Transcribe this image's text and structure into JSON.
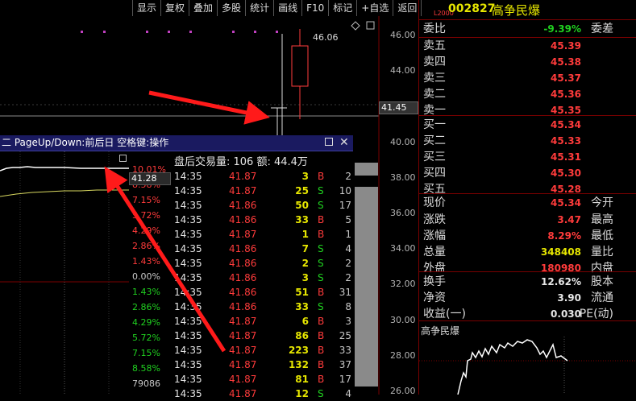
{
  "toolbar": [
    "显示",
    "复权",
    "叠加",
    "多股",
    "统计",
    "画线",
    "F10",
    "标记",
    "+自选",
    "返回"
  ],
  "stock": {
    "code": "002827",
    "name": "高争民爆",
    "badge": "L2000"
  },
  "quote": [
    {
      "label": "委比",
      "value": "-9.39%",
      "label2": "委差",
      "color": "#20d020"
    },
    {
      "label": "卖五",
      "value": "45.39",
      "label2": "",
      "color": "#ff3b3b"
    },
    {
      "label": "卖四",
      "value": "45.38",
      "label2": "",
      "color": "#ff3b3b"
    },
    {
      "label": "卖三",
      "value": "45.37",
      "label2": "",
      "color": "#ff3b3b"
    },
    {
      "label": "卖二",
      "value": "45.36",
      "label2": "",
      "color": "#ff3b3b"
    },
    {
      "label": "卖一",
      "value": "45.35",
      "label2": "",
      "color": "#ff3b3b"
    },
    {
      "label": "买一",
      "value": "45.34",
      "label2": "",
      "color": "#ff3b3b"
    },
    {
      "label": "买二",
      "value": "45.33",
      "label2": "",
      "color": "#ff3b3b"
    },
    {
      "label": "买三",
      "value": "45.31",
      "label2": "",
      "color": "#ff3b3b"
    },
    {
      "label": "买四",
      "value": "45.30",
      "label2": "",
      "color": "#ff3b3b"
    },
    {
      "label": "买五",
      "value": "45.28",
      "label2": "",
      "color": "#ff3b3b"
    },
    {
      "label": "现价",
      "value": "45.34",
      "label2": "今开",
      "color": "#ff3b3b"
    },
    {
      "label": "涨跌",
      "value": "3.47",
      "label2": "最高",
      "color": "#ff3b3b"
    },
    {
      "label": "涨幅",
      "value": "8.29%",
      "label2": "最低",
      "color": "#ff3b3b"
    },
    {
      "label": "总量",
      "value": "348408",
      "label2": "量比",
      "color": "#e6e600"
    },
    {
      "label": "外盘",
      "value": "180980",
      "label2": "内盘",
      "color": "#ff3b3b"
    },
    {
      "label": "换手",
      "value": "12.62%",
      "label2": "股本",
      "color": "#e6e6e6"
    },
    {
      "label": "净资",
      "value": "3.90",
      "label2": "流通",
      "color": "#e6e6e6"
    },
    {
      "label": "收益(一)",
      "value": "0.030",
      "label2": "PE(动)",
      "color": "#e6e6e6"
    }
  ],
  "mini_title": "高争民爆",
  "price_axis": [
    "46.00",
    "44.00",
    "42.00",
    "40.00",
    "38.00",
    "36.00",
    "34.00",
    "32.00",
    "30.00",
    "28.00",
    "26.00"
  ],
  "current_price_box": "41.45",
  "candle_high_label": "46.06",
  "popup": {
    "title": "二 PageUp/Down:前后日 空格键:操作",
    "header": "盘后交易量: 106  额: 44.4万",
    "cursor_price": "41.28",
    "pct_labels": [
      {
        "t": "10.01%",
        "c": "#ff3b3b"
      },
      {
        "t": "8.58%",
        "c": "#ff3b3b"
      },
      {
        "t": "7.15%",
        "c": "#ff3b3b"
      },
      {
        "t": "5.72%",
        "c": "#ff3b3b"
      },
      {
        "t": "4.29%",
        "c": "#ff3b3b"
      },
      {
        "t": "2.86%",
        "c": "#ff3b3b"
      },
      {
        "t": "1.43%",
        "c": "#ff3b3b"
      },
      {
        "t": "0.00%",
        "c": "#c8c8c8"
      },
      {
        "t": "1.43%",
        "c": "#20d020"
      },
      {
        "t": "2.86%",
        "c": "#20d020"
      },
      {
        "t": "4.29%",
        "c": "#20d020"
      },
      {
        "t": "5.72%",
        "c": "#20d020"
      },
      {
        "t": "7.15%",
        "c": "#20d020"
      },
      {
        "t": "8.58%",
        "c": "#20d020"
      },
      {
        "t": "79086",
        "c": "#c8c8c8"
      }
    ],
    "trades": [
      {
        "time": "14:35",
        "price": "41.87",
        "vol": "3",
        "bs": "B",
        "n": "2"
      },
      {
        "time": "14:35",
        "price": "41.87",
        "vol": "25",
        "bs": "S",
        "n": "10"
      },
      {
        "time": "14:35",
        "price": "41.86",
        "vol": "50",
        "bs": "S",
        "n": "17"
      },
      {
        "time": "14:35",
        "price": "41.86",
        "vol": "33",
        "bs": "B",
        "n": "5"
      },
      {
        "time": "14:35",
        "price": "41.87",
        "vol": "1",
        "bs": "B",
        "n": "1"
      },
      {
        "time": "14:35",
        "price": "41.86",
        "vol": "7",
        "bs": "S",
        "n": "4"
      },
      {
        "time": "14:35",
        "price": "41.86",
        "vol": "2",
        "bs": "S",
        "n": "2"
      },
      {
        "time": "14:35",
        "price": "41.86",
        "vol": "3",
        "bs": "S",
        "n": "2"
      },
      {
        "time": "14:35",
        "price": "41.86",
        "vol": "51",
        "bs": "B",
        "n": "31"
      },
      {
        "time": "14:35",
        "price": "41.86",
        "vol": "33",
        "bs": "S",
        "n": "8"
      },
      {
        "time": "14:35",
        "price": "41.87",
        "vol": "6",
        "bs": "B",
        "n": "3"
      },
      {
        "time": "14:35",
        "price": "41.87",
        "vol": "86",
        "bs": "B",
        "n": "25"
      },
      {
        "time": "14:35",
        "price": "41.87",
        "vol": "223",
        "bs": "B",
        "n": "33"
      },
      {
        "time": "14:35",
        "price": "41.87",
        "vol": "132",
        "bs": "B",
        "n": "37"
      },
      {
        "time": "14:35",
        "price": "41.87",
        "vol": "81",
        "bs": "B",
        "n": "17"
      },
      {
        "time": "14:35",
        "price": "41.87",
        "vol": "12",
        "bs": "S",
        "n": "4"
      }
    ]
  }
}
